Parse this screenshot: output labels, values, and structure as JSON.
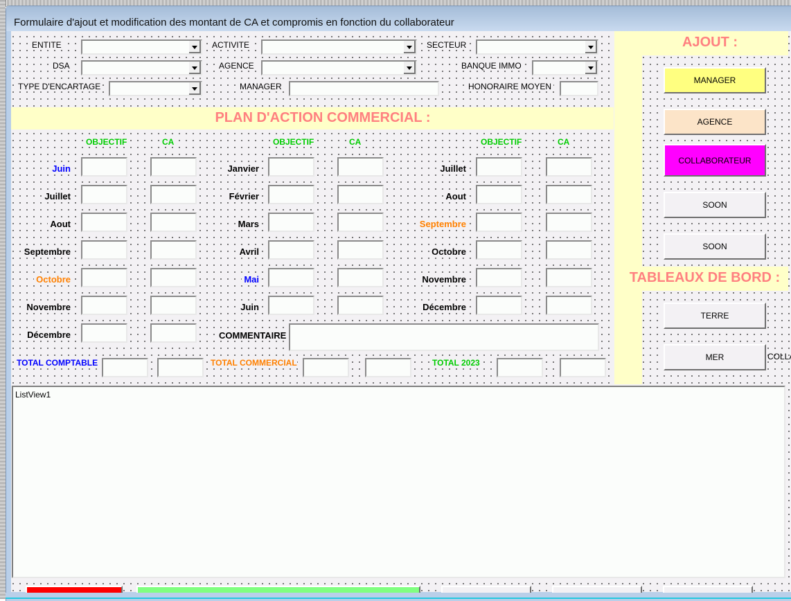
{
  "window": {
    "title": "Formulaire d'ajout et modification des montant de CA et compromis en fonction du collaborateur"
  },
  "filters": {
    "entite": {
      "label": "ENTITE",
      "value": ""
    },
    "activite": {
      "label": "ACTIVITE",
      "value": ""
    },
    "secteur": {
      "label": "SECTEUR",
      "value": ""
    },
    "dsa": {
      "label": "DSA",
      "value": ""
    },
    "agence": {
      "label": "AGENCE",
      "value": ""
    },
    "banque_immo": {
      "label": "BANQUE IMMO",
      "value": ""
    },
    "type_encartage": {
      "label": "TYPE D'ENCARTAGE",
      "value": ""
    },
    "manager": {
      "label": "MANAGER",
      "value": ""
    },
    "honoraire_moyen": {
      "label": "HONORAIRE MOYEN",
      "value": ""
    }
  },
  "plan": {
    "title": "PLAN D'ACTION COMMERCIAL :",
    "objectif_header": "OBJECTIF",
    "ca_header": "CA",
    "columns": [
      {
        "months": [
          {
            "label": "Juin",
            "color": "#0000ff"
          },
          {
            "label": "Juillet",
            "color": "#000000"
          },
          {
            "label": "Aout",
            "color": "#000000"
          },
          {
            "label": "Septembre",
            "color": "#000000"
          },
          {
            "label": "Octobre",
            "color": "#ff8000"
          },
          {
            "label": "Novembre",
            "color": "#000000"
          },
          {
            "label": "Décembre",
            "color": "#000000"
          }
        ]
      },
      {
        "months": [
          {
            "label": "Janvier",
            "color": "#000000"
          },
          {
            "label": "Février",
            "color": "#000000"
          },
          {
            "label": "Mars",
            "color": "#000000"
          },
          {
            "label": "Avril",
            "color": "#000000"
          },
          {
            "label": "Mai",
            "color": "#0000ff"
          },
          {
            "label": "Juin",
            "color": "#000000"
          }
        ]
      },
      {
        "months": [
          {
            "label": "Juillet",
            "color": "#000000"
          },
          {
            "label": "Aout",
            "color": "#000000"
          },
          {
            "label": "Septembre",
            "color": "#ff8000"
          },
          {
            "label": "Octobre",
            "color": "#000000"
          },
          {
            "label": "Novembre",
            "color": "#000000"
          },
          {
            "label": "Décembre",
            "color": "#000000"
          }
        ]
      }
    ],
    "commentaire_label": "COMMENTAIRE",
    "commentaire": "",
    "totals": [
      {
        "label": "TOTAL COMPTABLE",
        "color": "#0000ff"
      },
      {
        "label": "TOTAL COMMERCIAL",
        "color": "#ff8000"
      },
      {
        "label": "TOTAL 2023",
        "color": "#00cc00"
      }
    ]
  },
  "ajout": {
    "title": "AJOUT :",
    "buttons": [
      {
        "label": "MANAGER",
        "color": "#ffff80"
      },
      {
        "label": "AGENCE",
        "color": "#fce4c8"
      },
      {
        "label": "COLLABORATEUR",
        "color": "#ff00ff"
      },
      {
        "label": "SOON",
        "color": "#f3f1f4"
      },
      {
        "label": "SOON",
        "color": "#f3f1f4"
      }
    ]
  },
  "tableaux": {
    "title": "TABLEAUX DE BORD :",
    "buttons": [
      {
        "label": "TERRE"
      },
      {
        "label": "MER"
      }
    ],
    "clipped_label": "COLLA"
  },
  "listview": {
    "label": "ListView1"
  },
  "status_bars": [
    {
      "color": "#ff0000"
    },
    {
      "color": "#80ff80"
    },
    {
      "color": "#f3f1f4"
    },
    {
      "color": "#f3f1f4"
    },
    {
      "color": "#f3f1f4"
    }
  ]
}
